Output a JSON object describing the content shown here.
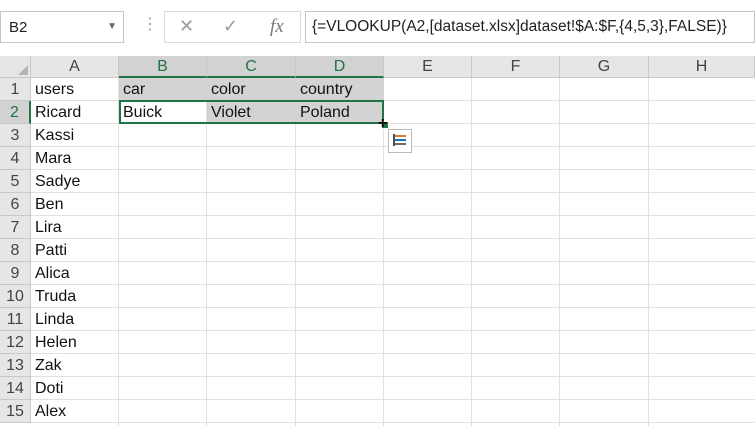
{
  "namebox": {
    "value": "B2",
    "dropdown_icon": "chevron-down-icon"
  },
  "formula_bar": {
    "dots": "⋮",
    "cancel_icon": "✕",
    "enter_icon": "✓",
    "fx_icon": "fx",
    "formula": "{=VLOOKUP(A2,[dataset.xlsx]dataset!$A:$F,{4,5,3},FALSE)}"
  },
  "columns": [
    "A",
    "B",
    "C",
    "D",
    "E",
    "F",
    "G",
    "H"
  ],
  "selected_columns": [
    "B",
    "C",
    "D"
  ],
  "rows": [
    "1",
    "2",
    "3",
    "4",
    "5",
    "6",
    "7",
    "8",
    "9",
    "10",
    "11",
    "12",
    "13",
    "14",
    "15"
  ],
  "selected_row": "2",
  "cells": {
    "A": [
      "users",
      "Ricard",
      "Kassi",
      "Mara",
      "Sadye",
      "Ben",
      "Lira",
      "Patti",
      "Alica",
      "Truda",
      "Linda",
      "Helen",
      "Zak",
      "Doti",
      "Alex"
    ],
    "B1": "car",
    "C1": "color",
    "D1": "country",
    "B2": "Buick",
    "C2": "Violet",
    "D2": "Poland"
  },
  "colors": {
    "accent": "#217346",
    "header_bg": "#e6e6e6",
    "selected_header_bg": "#d2d2d2",
    "shaded_cell": "#d3d3d3"
  },
  "icons": {
    "quick_analysis": "quick-analysis-icon",
    "fill_cursor": "crosshair-cursor-icon"
  }
}
